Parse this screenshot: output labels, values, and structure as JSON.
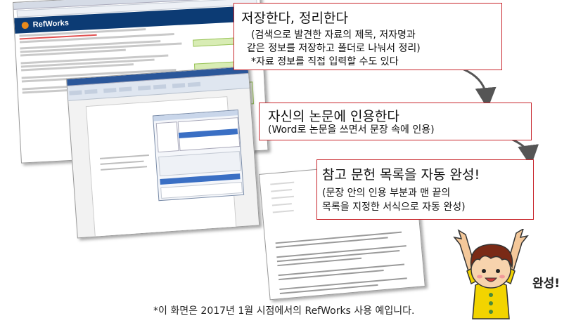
{
  "screenshot1": {
    "app_name": "RefWorks"
  },
  "callouts": [
    {
      "title": "저장한다, 정리한다",
      "lines": [
        "(검색으로 발견한 자료의 제목, 저자명과",
        "같은 정보를 저장하고 폴더로 나눠서 정리)",
        "*자료 정보를 직접 입력할 수도 있다"
      ]
    },
    {
      "title": "자신의 논문에 인용한다",
      "lines": [
        "(Word로 논문을 쓰면서 문장 속에 인용)"
      ]
    },
    {
      "title": "참고 문헌 목록을 자동 완성!",
      "lines": [
        "(문장 안의 인용 부분과 맨 끝의",
        "목록을 지정한 서식으로 자동 완성)"
      ]
    }
  ],
  "character_label": "완성!",
  "footnote": "*이 화면은 2017년 1월 시점에서의 RefWorks 사용 예입니다.",
  "colors": {
    "callout_border": "#c8262c",
    "refworks_header": "#0c3b74",
    "arrow": "#555555",
    "character_shirt": "#f2d400",
    "character_hair": "#7a2a16"
  },
  "icons": [
    "refworks-logo-icon",
    "curved-arrow-icon",
    "character-illustration"
  ]
}
